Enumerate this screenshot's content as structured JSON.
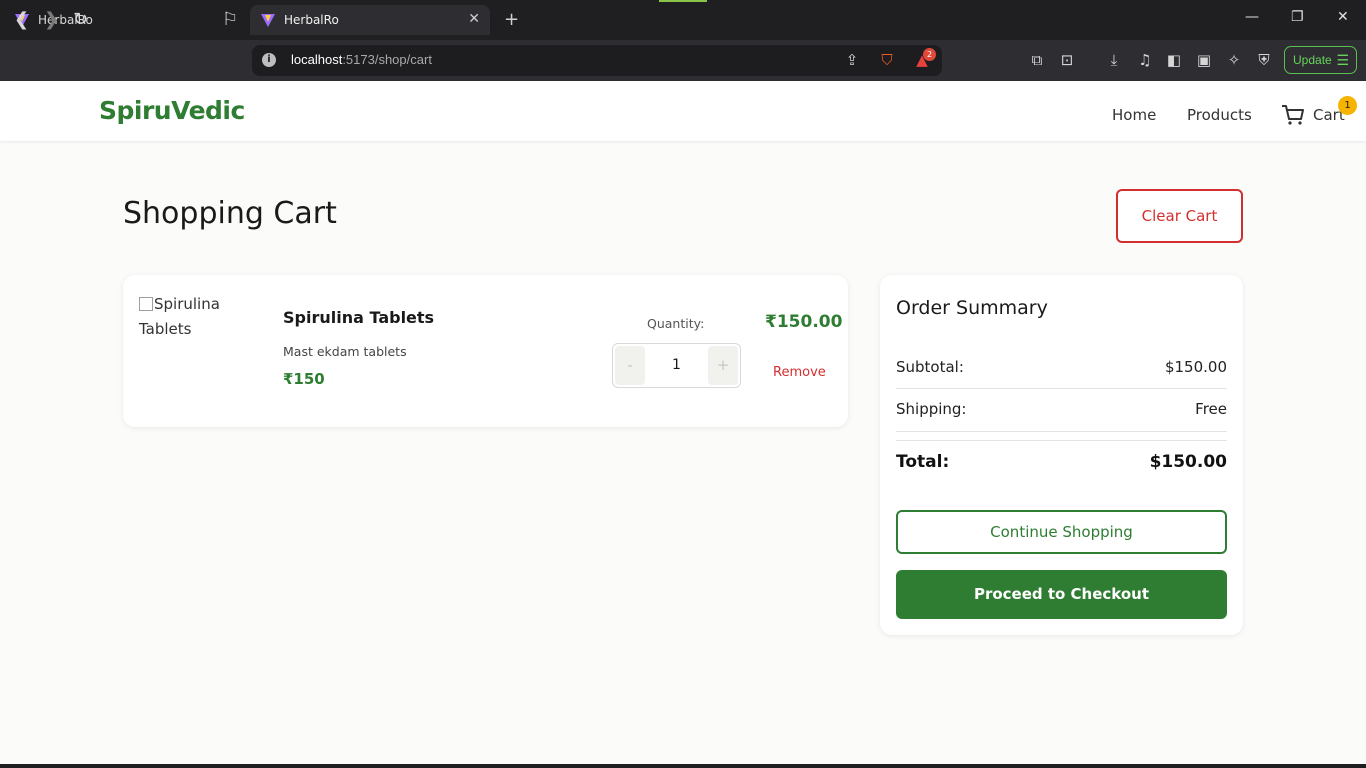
{
  "browser": {
    "tabs": [
      {
        "title": "HerbalRo",
        "active": false
      },
      {
        "title": "HerbalRo",
        "active": true
      }
    ],
    "url": {
      "host": "localhost",
      "path": ":5173/shop/cart"
    },
    "brave_badge": "2",
    "update_label": "Update",
    "icons": [
      "back-icon",
      "forward-icon",
      "reload-icon",
      "bookmark-icon",
      "share-icon",
      "brave-shield-icon",
      "brave-rewards-icon",
      "extensions-icon",
      "reader-icon",
      "download-icon",
      "music-icon",
      "sidebar-icon",
      "wallet-icon",
      "leo-icon",
      "vpn-icon",
      "menu-icon"
    ]
  },
  "site": {
    "logo": "SpiruVedic",
    "nav": {
      "home": "Home",
      "products": "Products",
      "cart": "Cart",
      "cart_count": "1"
    }
  },
  "page": {
    "title": "Shopping Cart",
    "clear_cart": "Clear Cart"
  },
  "cart": {
    "items": [
      {
        "image_alt": "Spirulina Tablets",
        "name": "Spirulina Tablets",
        "description": "Mast ekdam tablets",
        "unit_price": "₹150",
        "quantity_label": "Quantity:",
        "quantity": "1",
        "decrement": "-",
        "increment": "+",
        "line_total": "₹150.00",
        "remove": "Remove"
      }
    ]
  },
  "summary": {
    "title": "Order Summary",
    "subtotal_label": "Subtotal:",
    "subtotal": "$150.00",
    "shipping_label": "Shipping:",
    "shipping": "Free",
    "total_label": "Total:",
    "total": "$150.00",
    "continue": "Continue Shopping",
    "checkout": "Proceed to Checkout"
  },
  "colors": {
    "brand": "#2e7d32",
    "danger": "#d32f2f",
    "badge": "#f6b400"
  }
}
